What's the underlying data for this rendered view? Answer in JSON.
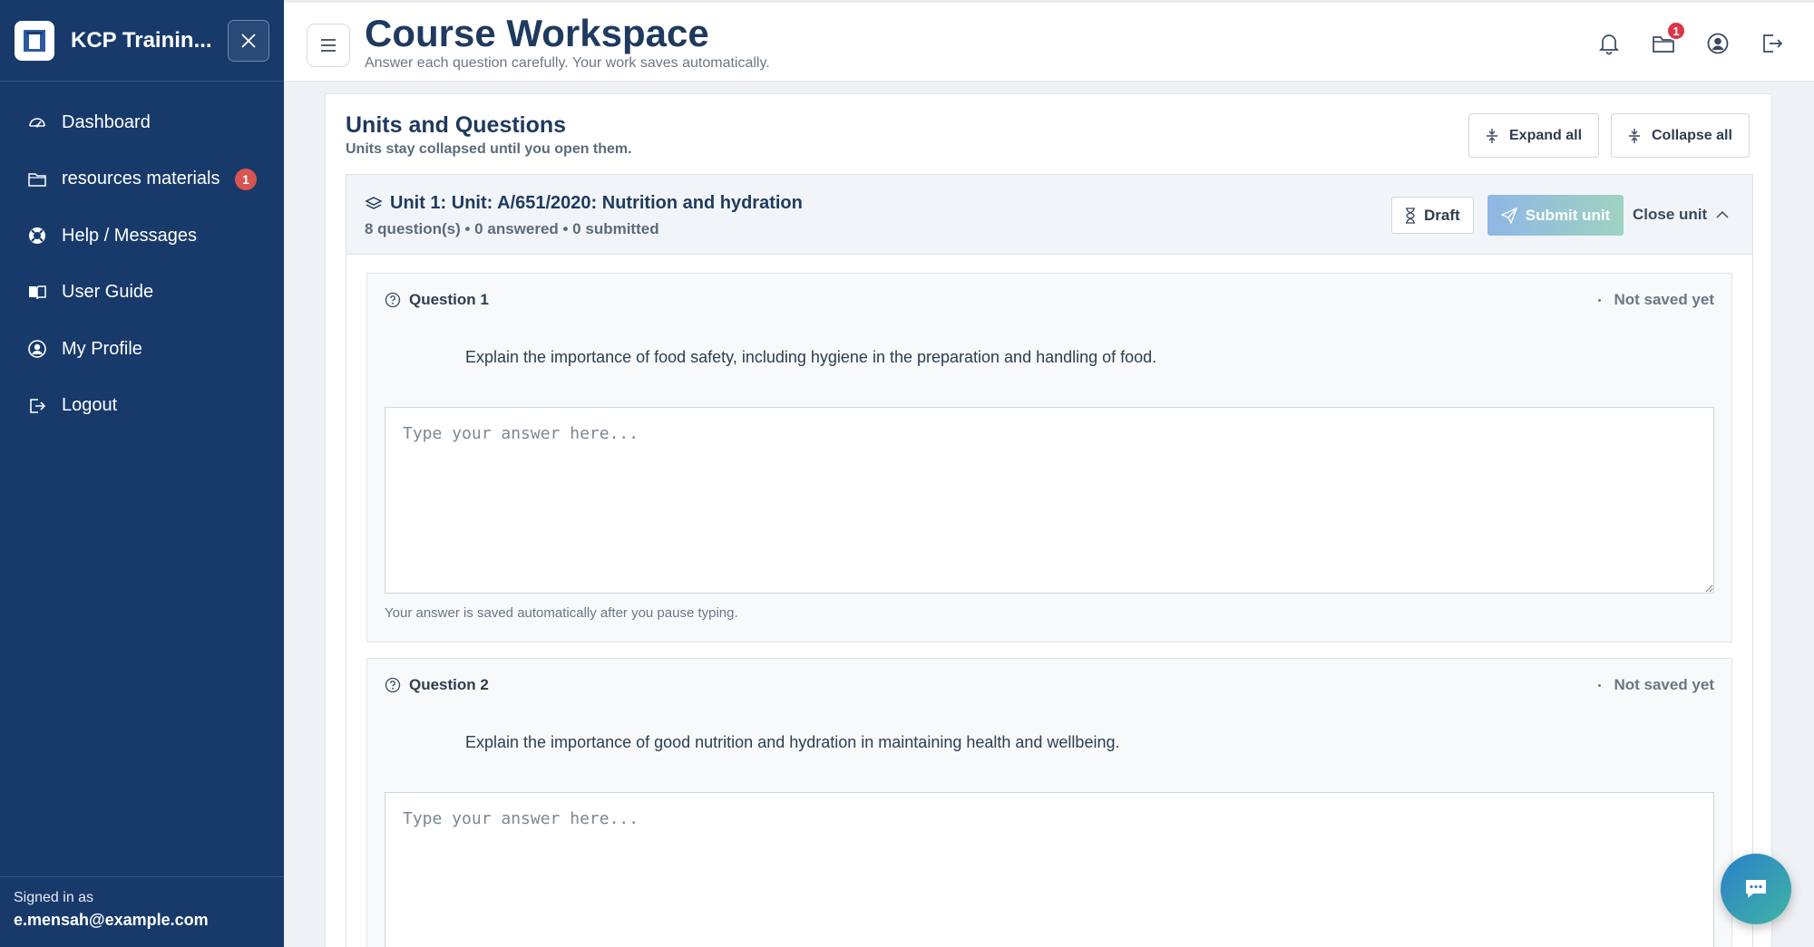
{
  "sidebar": {
    "brand": "KCP Trainin...",
    "items": [
      {
        "label": "Dashboard",
        "icon": "gauge-icon"
      },
      {
        "label": "resources materials",
        "icon": "folder-icon",
        "badge": "1"
      },
      {
        "label": "Help / Messages",
        "icon": "lifebuoy-icon"
      },
      {
        "label": "User Guide",
        "icon": "book-icon"
      },
      {
        "label": "My Profile",
        "icon": "user-circle-icon"
      },
      {
        "label": "Logout",
        "icon": "logout-icon"
      }
    ],
    "footer": {
      "label": "Signed in as",
      "email": "e.mensah@example.com"
    }
  },
  "header": {
    "title": "Course Workspace",
    "subtitle": "Answer each question carefully. Your work saves automatically.",
    "folder_badge": "1"
  },
  "panel": {
    "title": "Units and Questions",
    "subtitle": "Units stay collapsed until you open them.",
    "expand_label": "Expand all",
    "collapse_label": "Collapse all"
  },
  "unit": {
    "title": "Unit 1: Unit: A/651/2020: Nutrition and hydration",
    "meta": "8 question(s) • 0 answered • 0 submitted",
    "draft_label": "Draft",
    "submit_label": "Submit unit",
    "close_label": "Close unit"
  },
  "questions": [
    {
      "label": "Question 1",
      "status": "Not saved yet",
      "text": "Explain the importance of food safety, including hygiene in the preparation and handling of food.",
      "placeholder": "Type your answer here...",
      "help": "Your answer is saved automatically after you pause typing."
    },
    {
      "label": "Question 2",
      "status": "Not saved yet",
      "text": "Explain the importance of good nutrition and hydration in maintaining health and wellbeing.",
      "placeholder": "Type your answer here..."
    }
  ],
  "colors": {
    "sidebar_bg": "#173a6b",
    "title": "#1f3a5f",
    "badge": "#d9534f",
    "submit_gradient_start": "#8fb6e6",
    "submit_gradient_end": "#9fd3c0"
  }
}
